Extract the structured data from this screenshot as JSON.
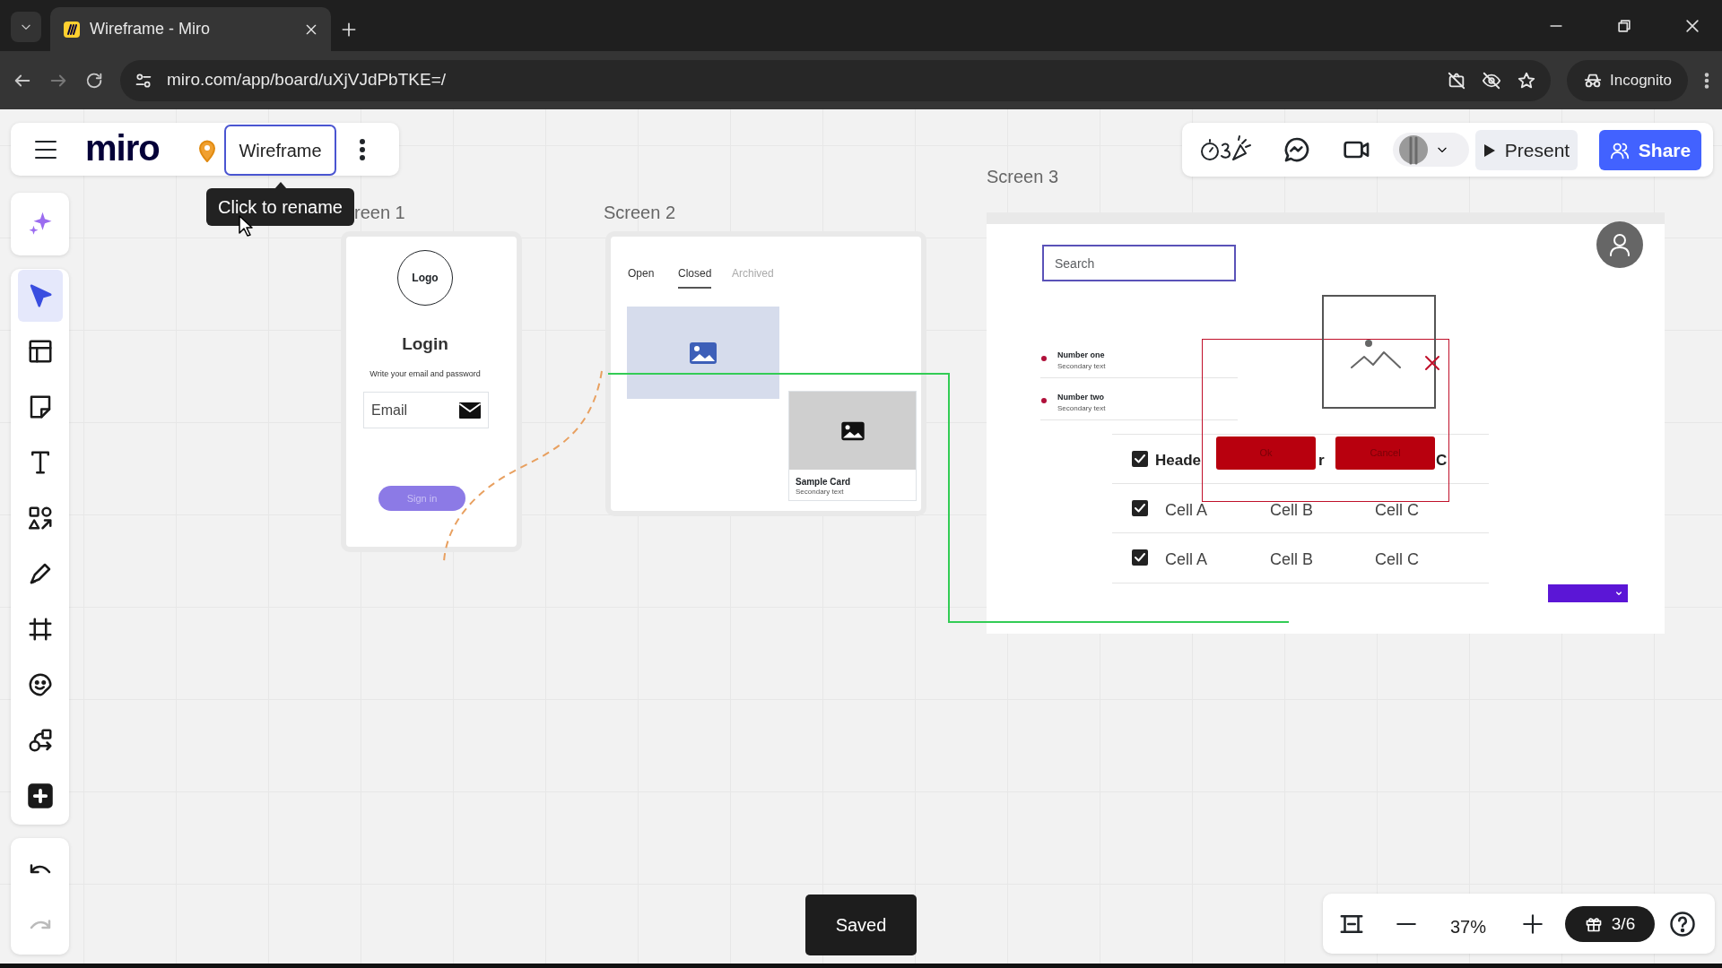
{
  "browser": {
    "tab_title": "Wireframe - Miro",
    "url": "miro.com/app/board/uXjVJdPbTKE=/",
    "profile": "Incognito"
  },
  "board_bar": {
    "logo": "miro",
    "board_name": "Wireframe",
    "tooltip": "Click to rename"
  },
  "toolbar": [
    {
      "kind": "ai",
      "selected": false
    },
    {
      "kind": "select",
      "selected": true
    },
    {
      "kind": "templates",
      "selected": false
    },
    {
      "kind": "sticky",
      "selected": false
    },
    {
      "kind": "text",
      "selected": false
    },
    {
      "kind": "shapes",
      "selected": false
    },
    {
      "kind": "pen",
      "selected": false
    },
    {
      "kind": "frame",
      "selected": false
    },
    {
      "kind": "stickers",
      "selected": false
    },
    {
      "kind": "diagram",
      "selected": false
    },
    {
      "kind": "add",
      "selected": false
    }
  ],
  "history": [
    {
      "kind": "undo",
      "disabled": false
    },
    {
      "kind": "redo",
      "disabled": true
    }
  ],
  "top_right": {
    "present": "Present",
    "share": "Share"
  },
  "frames": [
    {
      "kind": "login",
      "label": "reen 1",
      "logo": "Logo",
      "title": "Login",
      "subtitle": "Write your email and password",
      "email": "Email",
      "button": "Sign in"
    },
    {
      "kind": "tabs",
      "label": "Screen 2",
      "tabs": [
        {
          "label": "Open",
          "selected": false,
          "disabled": false
        },
        {
          "label": "Closed",
          "selected": true,
          "disabled": false
        },
        {
          "label": "Archived",
          "selected": false,
          "disabled": true
        }
      ],
      "card_title": "Sample Card",
      "card_subtitle": "Secondary text"
    },
    {
      "kind": "dashboard",
      "label": "Screen 3",
      "search": {
        "placeholder": "Search"
      },
      "list": [
        {
          "title": "Number one",
          "subtitle": "Secondary text"
        },
        {
          "title": "Number two",
          "subtitle": "Secondary text"
        }
      ],
      "table": {
        "columns": [
          "Heade",
          "r",
          "C"
        ],
        "rows": [
          {
            "checked": true,
            "cells": [
              "Cell A",
              "Cell B",
              "Cell C"
            ]
          },
          {
            "checked": true,
            "cells": [
              "Cell A",
              "Cell B",
              "Cell C"
            ]
          }
        ],
        "header_checked": true
      },
      "dialog": {
        "buttons": [
          "Ok",
          "Cancel"
        ]
      }
    }
  ],
  "status": {
    "saved": "Saved",
    "zoom": "37%",
    "onboarding": "3/6"
  }
}
